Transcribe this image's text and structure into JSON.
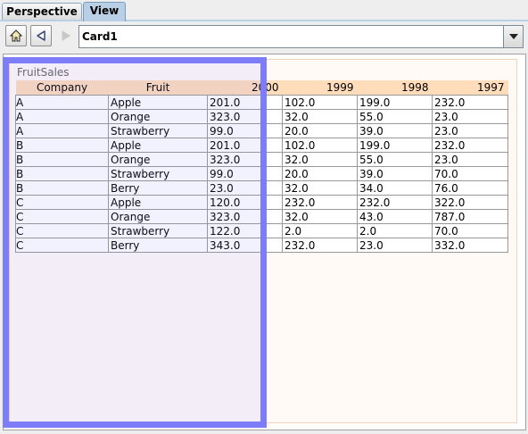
{
  "tabs": [
    {
      "label": "Perspective",
      "active": false
    },
    {
      "label": "View",
      "active": true
    }
  ],
  "toolbar": {
    "home_icon": "home-icon",
    "back_icon": "back-arrow-icon",
    "forward_icon": "forward-arrow-icon",
    "combo_value": "Card1",
    "combo_arrow_icon": "chevron-down-icon"
  },
  "card": {
    "title": "FruitSales"
  },
  "table": {
    "columns": [
      "Company",
      "Fruit",
      "2000",
      "1999",
      "1998",
      "1997"
    ],
    "rows": [
      [
        "A",
        "Apple",
        "201.0",
        "102.0",
        "199.0",
        "232.0"
      ],
      [
        "A",
        "Orange",
        "323.0",
        "32.0",
        "55.0",
        "23.0"
      ],
      [
        "A",
        "Strawberry",
        "99.0",
        "20.0",
        "39.0",
        "23.0"
      ],
      [
        "B",
        "Apple",
        "201.0",
        "102.0",
        "199.0",
        "232.0"
      ],
      [
        "B",
        "Orange",
        "323.0",
        "32.0",
        "55.0",
        "23.0"
      ],
      [
        "B",
        "Strawberry",
        "99.0",
        "20.0",
        "39.0",
        "70.0"
      ],
      [
        "B",
        "Berry",
        "23.0",
        "32.0",
        "34.0",
        "76.0"
      ],
      [
        "C",
        "Apple",
        "120.0",
        "232.0",
        "232.0",
        "322.0"
      ],
      [
        "C",
        "Orange",
        "323.0",
        "32.0",
        "43.0",
        "787.0"
      ],
      [
        "C",
        "Strawberry",
        "122.0",
        "2.0",
        "2.0",
        "70.0"
      ],
      [
        "C",
        "Berry",
        "343.0",
        "232.0",
        "23.0",
        "332.0"
      ]
    ]
  },
  "colors": {
    "header_bg": "#ffddbb",
    "selection": "#7d7dfa",
    "active_tab": "#b8cfe5"
  }
}
